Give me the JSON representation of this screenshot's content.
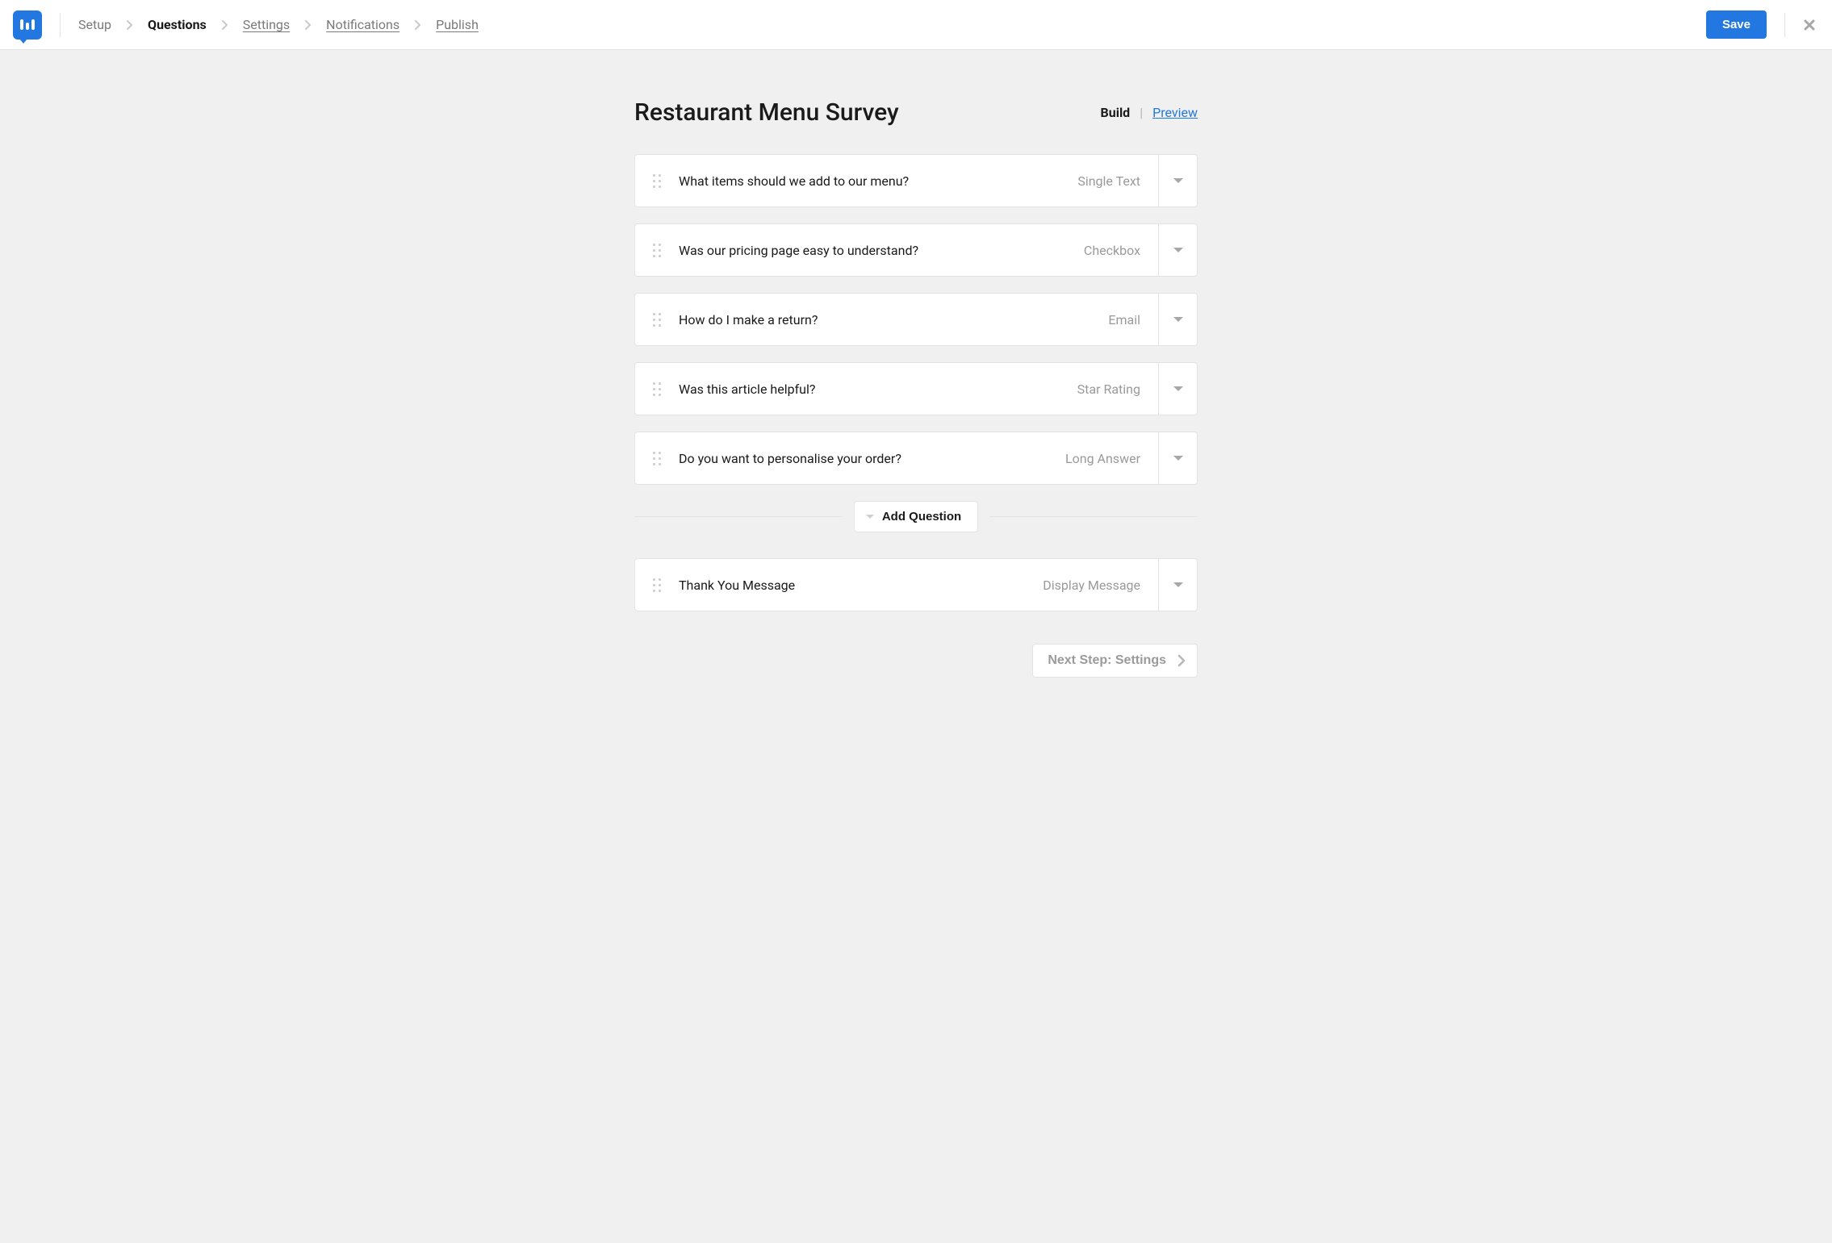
{
  "header": {
    "crumbs": [
      "Setup",
      "Questions",
      "Settings",
      "Notifications",
      "Publish"
    ],
    "active_index": 1,
    "save_label": "Save"
  },
  "survey": {
    "title": "Restaurant Menu Survey",
    "mode_build": "Build",
    "mode_preview": "Preview"
  },
  "questions": [
    {
      "text": "What items should we add to our menu?",
      "type": "Single Text"
    },
    {
      "text": "Was our pricing page easy to understand?",
      "type": "Checkbox"
    },
    {
      "text": "How do I make a return?",
      "type": "Email"
    },
    {
      "text": "Was this article helpful?",
      "type": "Star Rating"
    },
    {
      "text": "Do you want to personalise your order?",
      "type": "Long Answer"
    }
  ],
  "add_question_label": "Add Question",
  "thank_you": {
    "text": "Thank You Message",
    "type": "Display Message"
  },
  "next_step_label": "Next Step: Settings"
}
